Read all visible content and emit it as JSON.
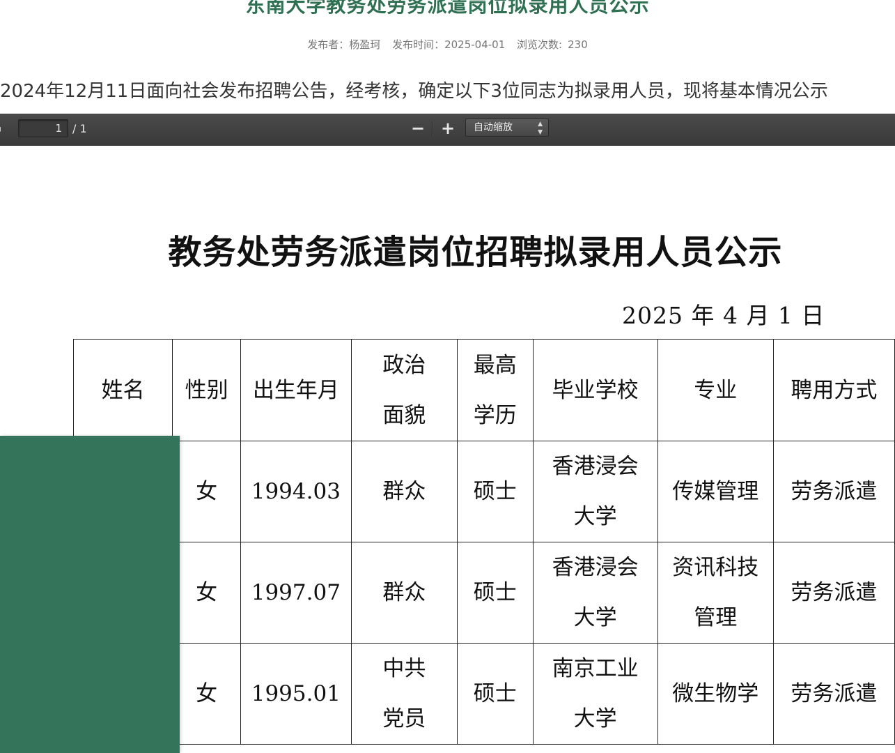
{
  "header": {
    "title": "东南大学教务处劳务派遣岗位拟录用人员公示",
    "publisher_label": "发布者：",
    "publisher": "杨盈珂",
    "date_label": "发布时间：",
    "date": "2025-04-01",
    "views_label": "浏览次数:",
    "views": "230"
  },
  "intro": "2024年12月11日面向社会发布招聘公告，经考核，确定以下3位同志为拟录用人员，现将基本情况公示",
  "pdf_toolbar": {
    "page_current": "1",
    "page_total": "/ 1",
    "zoom_out": "−",
    "zoom_in": "+",
    "zoom_mode": "自动缩放"
  },
  "document": {
    "title": "教务处劳务派遣岗位招聘拟录用人员公示",
    "date": "2025 年 4 月 1 日",
    "table": {
      "headers": [
        {
          "line1": "姓名",
          "line2": ""
        },
        {
          "line1": "性别",
          "line2": ""
        },
        {
          "line1": "出生年月",
          "line2": ""
        },
        {
          "line1": "政治",
          "line2": "面貌"
        },
        {
          "line1": "最高",
          "line2": "学历"
        },
        {
          "line1": "毕业学校",
          "line2": ""
        },
        {
          "line1": "专业",
          "line2": ""
        },
        {
          "line1": "聘用方式",
          "line2": ""
        }
      ],
      "rows": [
        {
          "name": "",
          "gender": "女",
          "birth": "1994.03",
          "political_1": "群众",
          "political_2": "",
          "degree": "硕士",
          "school_1": "香港浸会",
          "school_2": "大学",
          "major_1": "传媒管理",
          "major_2": "",
          "employment": "劳务派遣"
        },
        {
          "name": "",
          "gender": "女",
          "birth": "1997.07",
          "political_1": "群众",
          "political_2": "",
          "degree": "硕士",
          "school_1": "香港浸会",
          "school_2": "大学",
          "major_1": "资讯科技",
          "major_2": "管理",
          "employment": "劳务派遣"
        },
        {
          "name": "",
          "gender": "女",
          "birth": "1995.01",
          "political_1": "中共",
          "political_2": "党员",
          "degree": "硕士",
          "school_1": "南京工业",
          "school_2": "大学",
          "major_1": "微生物学",
          "major_2": "",
          "employment": "劳务派遣"
        }
      ]
    }
  },
  "colors": {
    "title_green": "#2f6f52",
    "redaction": "#34745a",
    "toolbar_bg": "#404040"
  }
}
